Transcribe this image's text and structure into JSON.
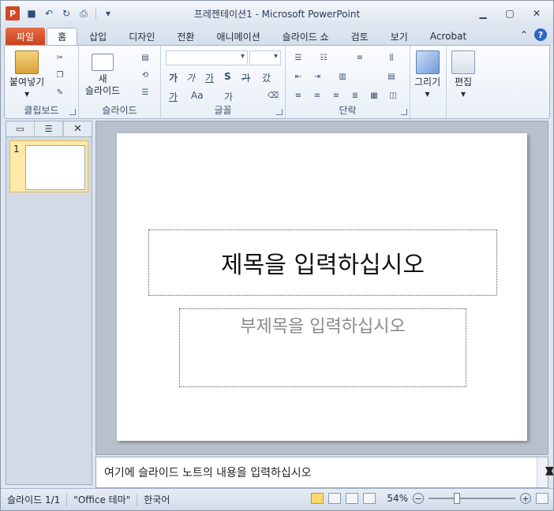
{
  "window": {
    "title": "프레젠테이션1 - Microsoft PowerPoint"
  },
  "tabs": [
    {
      "label": "파일"
    },
    {
      "label": "홈"
    },
    {
      "label": "삽입"
    },
    {
      "label": "디자인"
    },
    {
      "label": "전환"
    },
    {
      "label": "애니메이션"
    },
    {
      "label": "슬라이드 쇼"
    },
    {
      "label": "검토"
    },
    {
      "label": "보기"
    },
    {
      "label": "Acrobat"
    }
  ],
  "ribbon": {
    "clipboard": {
      "paste_label": "붙여넣기",
      "group_label": "클립보드"
    },
    "slides": {
      "new_slide_label_1": "새",
      "new_slide_label_2": "슬라이드",
      "group_label": "슬라이드"
    },
    "font": {
      "group_label": "글꼴",
      "bold": "가",
      "italic": "가",
      "underline": "가",
      "shadow": "S",
      "strike": "가",
      "spacing": "갔",
      "grow": "가",
      "shrink": "가",
      "case": "Aa"
    },
    "paragraph": {
      "group_label": "단락"
    },
    "drawing": {
      "label": "그리기"
    },
    "editing": {
      "label": "편집"
    }
  },
  "slides_pane": {
    "slide_number": "1"
  },
  "slide": {
    "title_placeholder": "제목을 입력하십시오",
    "subtitle_placeholder": "부제목을 입력하십시오"
  },
  "notes": {
    "placeholder": "여기에 슬라이드 노트의 내용을 입력하십시오"
  },
  "status": {
    "slide_count": "슬라이드 1/1",
    "theme": "\"Office 테마\"",
    "language": "한국어",
    "zoom": "54%"
  }
}
